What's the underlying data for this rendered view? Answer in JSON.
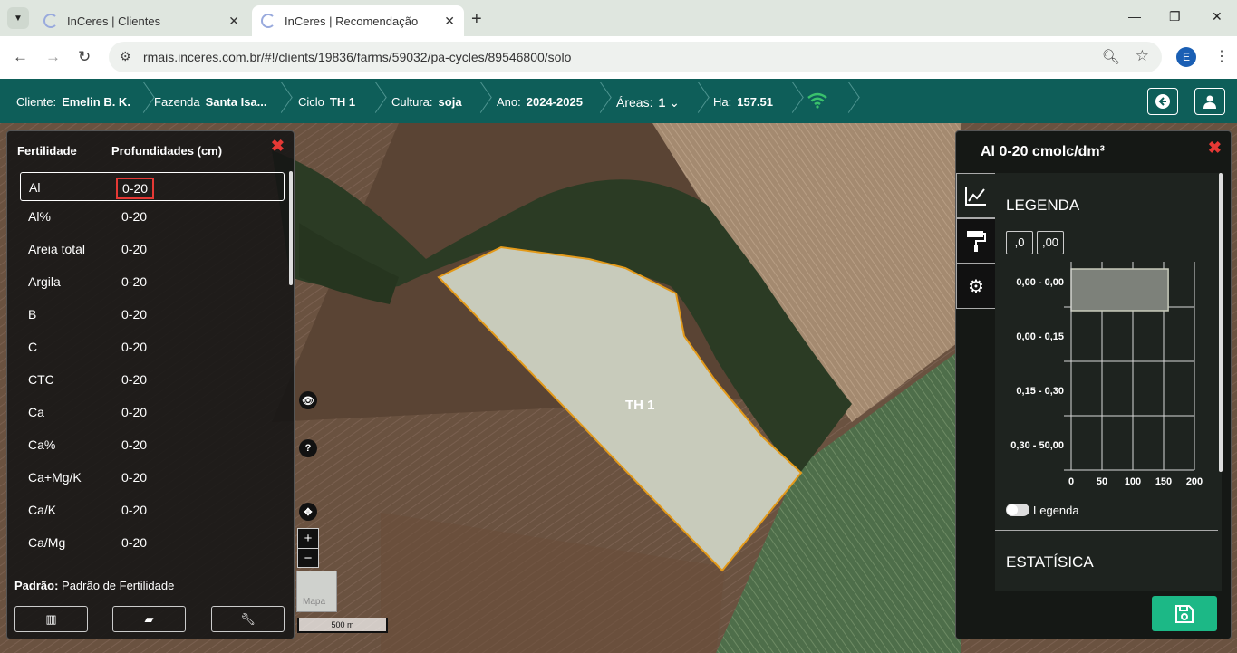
{
  "browser": {
    "tabs": [
      {
        "title": "InCeres | Clientes",
        "active": false
      },
      {
        "title": "InCeres | Recomendação",
        "active": true
      }
    ],
    "url": "rmais.inceres.com.br/#!/clients/19836/farms/59032/pa-cycles/89546800/solo",
    "profile_initial": "E"
  },
  "header": {
    "cliente_label": "Cliente:",
    "cliente_value": "Emelin B. K.",
    "fazenda_label": "Fazenda",
    "fazenda_value": "Santa Isa...",
    "ciclo_label": "Ciclo",
    "ciclo_value": "TH 1",
    "cultura_label": "Cultura:",
    "cultura_value": "soja",
    "ano_label": "Ano:",
    "ano_value": "2024-2025",
    "areas_label": "Áreas:",
    "areas_value": "1",
    "ha_label": "Ha:",
    "ha_value": "157.51",
    "colors": {
      "bar": "#0e5e59",
      "wifi": "#39c16c"
    }
  },
  "left_panel": {
    "col1": "Fertilidade",
    "col2": "Profundidades (cm)",
    "rows": [
      {
        "name": "Al",
        "depth": "0-20",
        "selected": true
      },
      {
        "name": "Al%",
        "depth": "0-20"
      },
      {
        "name": "Areia total",
        "depth": "0-20"
      },
      {
        "name": "Argila",
        "depth": "0-20"
      },
      {
        "name": "B",
        "depth": "0-20"
      },
      {
        "name": "C",
        "depth": "0-20"
      },
      {
        "name": "CTC",
        "depth": "0-20"
      },
      {
        "name": "Ca",
        "depth": "0-20"
      },
      {
        "name": "Ca%",
        "depth": "0-20"
      },
      {
        "name": "Ca+Mg/K",
        "depth": "0-20"
      },
      {
        "name": "Ca/K",
        "depth": "0-20"
      },
      {
        "name": "Ca/Mg",
        "depth": "0-20"
      }
    ],
    "padrao_label": "Padrão:",
    "padrao_value": "Padrão de Fertilidade"
  },
  "map": {
    "field_label": "TH 1",
    "map_type_label": "Mapa",
    "scale_label": "500 m",
    "zoom_in": "+",
    "zoom_out": "−"
  },
  "right_panel": {
    "title": "Al 0-20 cmolc/dm³",
    "legend_title": "LEGENDA",
    "decimal_less": ",0",
    "decimal_more": ",00",
    "legend_toggle_label": "Legenda",
    "stats_title": "ESTATÍSICA",
    "chart_data": {
      "type": "bar",
      "orientation": "horizontal",
      "categories": [
        "0,00 - 0,00",
        "0,00 - 0,15",
        "0,15 - 0,30",
        "0,30 - 50,00"
      ],
      "values": [
        157.51,
        0,
        0,
        0
      ],
      "xlim": [
        0,
        200
      ],
      "xticks": [
        "0",
        "50",
        "100",
        "150",
        "200"
      ],
      "grid": true
    }
  }
}
